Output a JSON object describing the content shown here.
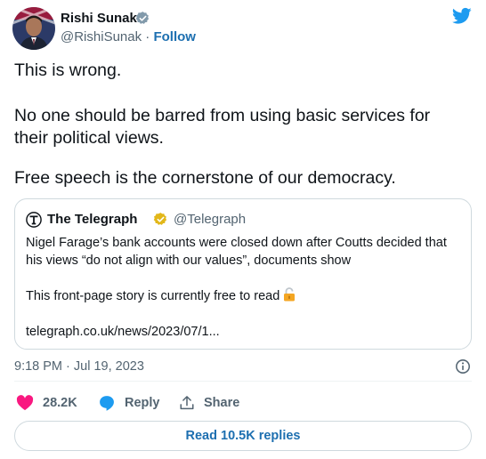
{
  "author": {
    "name": "Rishi Sunak",
    "handle": "@RishiSunak",
    "separator": "·",
    "follow_label": "Follow"
  },
  "tweet": {
    "line1": "This is wrong.",
    "line2": "No one should be barred from using basic services for",
    "line3": "their political views.",
    "line4": "Free speech is the cornerstone of our democracy."
  },
  "quote": {
    "name": "The Telegraph",
    "handle": "@Telegraph",
    "line1": "Nigel Farage’s bank accounts were closed down after Coutts decided that",
    "line2": "his views “do not align with our values”, documents show",
    "line3": "This front-page story is currently free to read",
    "link": "telegraph.co.uk/news/2023/07/1..."
  },
  "meta": {
    "timestamp": "9:18 PM · Jul 19, 2023"
  },
  "actions": {
    "likes": "28.2K",
    "reply_label": "Reply",
    "share_label": "Share",
    "read_replies_label": "Read 10.5K replies"
  },
  "colors": {
    "link_blue": "#1d6fb0",
    "twitter_blue": "#1d9bf0",
    "like_pink": "#f91880",
    "muted_text": "#536471",
    "gold_badge": "#e2b719"
  },
  "icons": [
    "avatar",
    "verified-badge-icon",
    "twitter-bird-icon",
    "telegraph-logo-icon",
    "gold-verified-badge-icon",
    "unlocked-padlock-icon",
    "info-icon",
    "heart-icon",
    "reply-bubble-icon",
    "share-icon"
  ]
}
